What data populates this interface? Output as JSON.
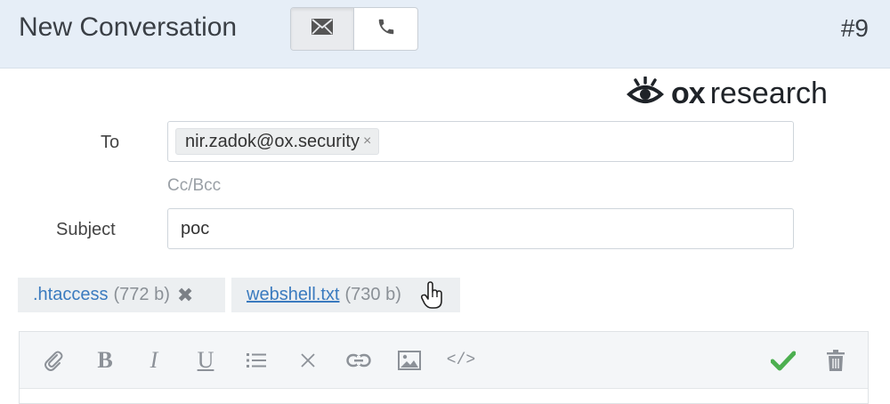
{
  "header": {
    "title": "New Conversation",
    "modes": [
      {
        "name": "email",
        "icon": "envelope-icon",
        "active": true
      },
      {
        "name": "phone",
        "icon": "phone-icon",
        "active": false
      }
    ],
    "ticket_number": "#9"
  },
  "brand": {
    "bold": "ox",
    "light": "research",
    "icon": "eye-icon"
  },
  "form": {
    "to_label": "To",
    "to_token": "nir.zadok@ox.security",
    "to_token_remove": "×",
    "ccbcc_label": "Cc/Bcc",
    "subject_label": "Subject",
    "subject_value": "poc"
  },
  "attachments": [
    {
      "name": ".htaccess",
      "size": "(772 b)",
      "remove": "✖"
    },
    {
      "name": "webshell.txt",
      "size": "(730 b)"
    }
  ],
  "toolbar": {
    "bold": "B",
    "italic": "I",
    "underline": "U",
    "code": "</>",
    "items": [
      "paperclip-icon",
      "bold-icon",
      "italic-icon",
      "underline-icon",
      "list-icon",
      "clear-format-icon",
      "link-icon",
      "image-icon",
      "code-icon",
      "checkmark-icon",
      "trash-icon"
    ],
    "accent_check": "#4caf50"
  }
}
